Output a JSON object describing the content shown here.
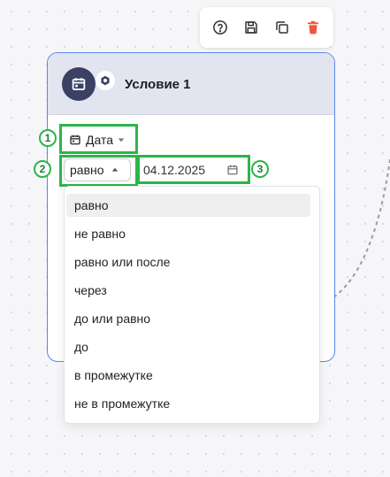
{
  "toolbar": {
    "help_icon": "help-circle-icon",
    "save_icon": "floppy-disk-icon",
    "duplicate_icon": "copy-icon",
    "delete_icon": "trash-icon",
    "delete_color": "#f0553f"
  },
  "card": {
    "title": "Условие 1",
    "icon": "calendar-icon",
    "badge_icon": "gear-icon",
    "border_color": "#5b86e8",
    "header_color": "#e2e5ef"
  },
  "condition": {
    "field_label": "Дата",
    "operator_value": "равно",
    "date_value": "04.12.2025"
  },
  "annotations": {
    "marker_1": "1",
    "marker_2": "2",
    "marker_3": "3",
    "color": "#2bb54a"
  },
  "dropdown": {
    "items": [
      {
        "label": "равно",
        "selected": true
      },
      {
        "label": "не равно"
      },
      {
        "label": "равно или после"
      },
      {
        "label": "через"
      },
      {
        "label": "до или равно"
      },
      {
        "label": "до"
      },
      {
        "label": "в промежутке"
      },
      {
        "label": "не в промежутке"
      }
    ]
  }
}
